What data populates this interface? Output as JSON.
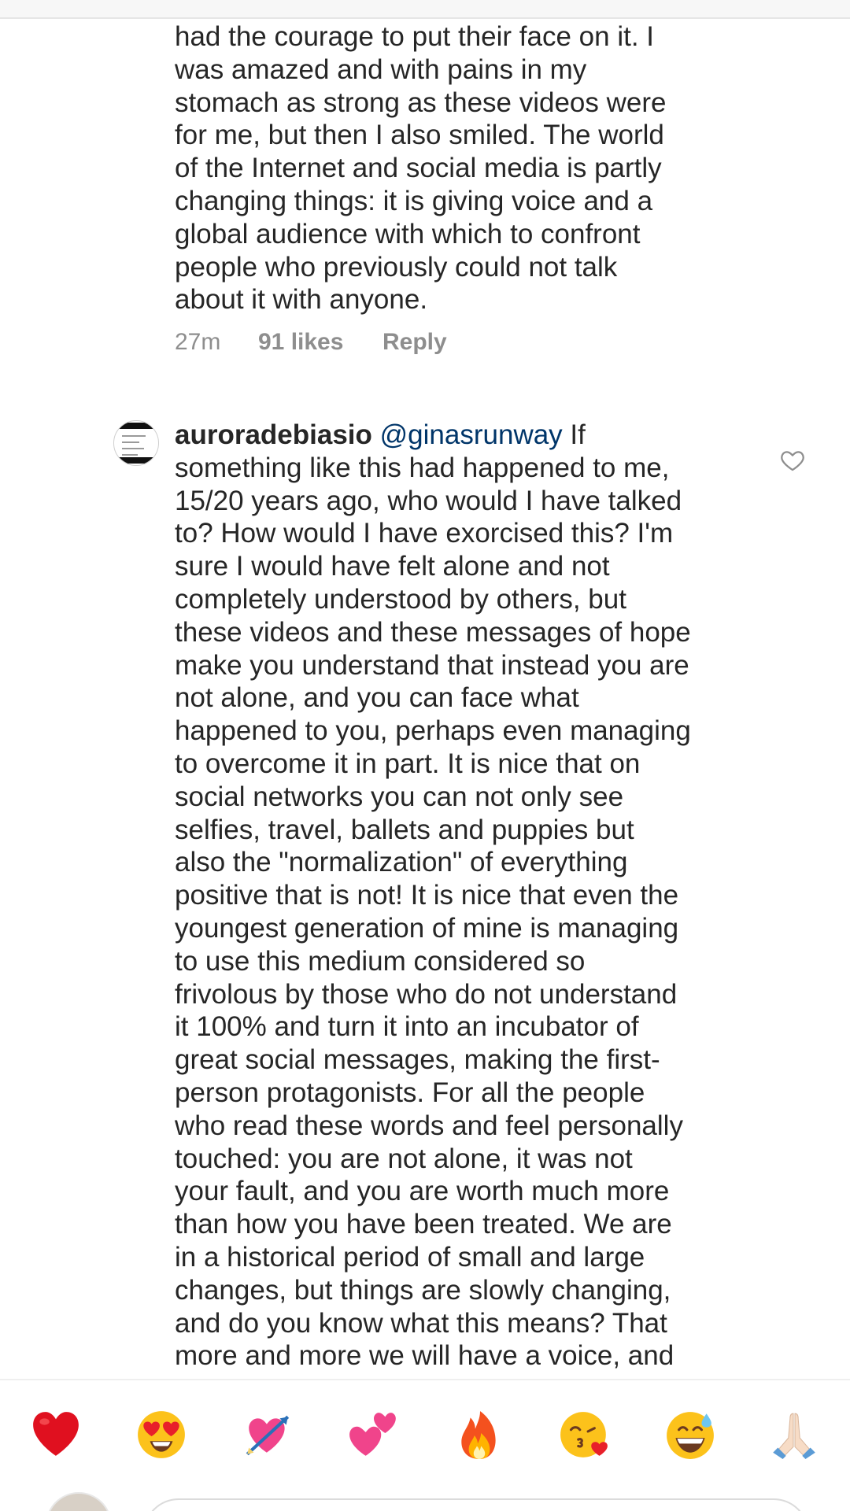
{
  "comment_1": {
    "text": "had the courage to put their face on it.  I\nwas amazed and with pains in my\nstomach as strong as these videos were\nfor me, but then I also smiled.  The world\nof the Internet and social media is partly\nchanging things: it is giving voice and a\nglobal audience with which to confront\npeople who previously could not talk\nabout it with anyone.",
    "time": "27m",
    "likes": "91 likes",
    "reply_label": "Reply"
  },
  "comment_2": {
    "username": "auroradebiasio",
    "mention": "@ginasrunway",
    "text": " If\nsomething like this had happened to me,\n15/20 years ago, who would I have talked\nto?  How would I have exorcised this?  I'm\nsure I would have felt alone and not\ncompletely understood by others, but\nthese videos and these messages of hope\nmake you understand that instead you are\nnot alone, and you can face what\nhappened to you, perhaps even managing\nto overcome it in part.  It is nice that on\nsocial networks you can not only see\nselfies, travel, ballets and puppies but\nalso the \"normalization\" of everything\npositive that is not!  It is nice that even the\nyoungest generation of mine is managing\nto use this medium considered so\nfrivolous by those who do not understand\nit 100% and turn it into an incubator of\ngreat social messages, making the first-\nperson protagonists.  For all the people\nwho read these words and feel personally\ntouched: you are not alone, it was not\nyour fault, and you are worth much more\nthan how you have been treated.  We are\nin a historical period of small and large\nchanges, but things are slowly changing,\nand do you know what this means?  That\nmore and more we will have a voice, and",
    "like_icon": "heart-outline-icon"
  },
  "emoji_bar": {
    "emojis": [
      "red-heart",
      "heart-eyes-face",
      "heart-with-arrow",
      "two-hearts",
      "fire",
      "face-blowing-kiss",
      "grinning-face-with-sweat",
      "folded-hands"
    ]
  },
  "colors": {
    "text": "#262626",
    "meta": "#8e8e8e",
    "mention": "#003569"
  }
}
